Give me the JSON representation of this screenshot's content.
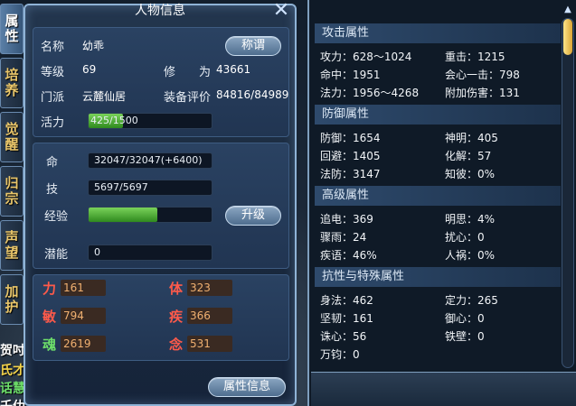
{
  "window": {
    "title": "人物信息",
    "close_glyph": "✕"
  },
  "side_tabs": [
    {
      "label": "属性",
      "active": true
    },
    {
      "label": "培养",
      "active": false
    },
    {
      "label": "觉醒",
      "active": false
    },
    {
      "label": "归宗",
      "active": false
    },
    {
      "label": "声望",
      "active": false
    },
    {
      "label": "加护",
      "active": false
    }
  ],
  "chat": [
    {
      "text": "贺吋"
    },
    {
      "text": "氏才"
    },
    {
      "text": "话慧"
    },
    {
      "text": "壬仂"
    }
  ],
  "profile": {
    "name_label": "名称",
    "name": "幼乖",
    "title_button": "称谓",
    "level_label": "等级",
    "level": "69",
    "cultivation_label": "修　　为",
    "cultivation": "43661",
    "sect_label": "门派",
    "sect": "云麓仙居",
    "equip_label": "装备评价",
    "equip_score": "84816/84989",
    "vitality_label": "活力",
    "vitality": "425/1500",
    "vitality_ratio": 0.283
  },
  "status": {
    "hp_label": "命",
    "hp": "32047/32047(+6400)",
    "skill_label": "技",
    "skill": "5697/5697",
    "exp_label": "经验",
    "exp_ratio": 0.56,
    "upgrade_button": "升级",
    "potential_label": "潜能",
    "potential": "0"
  },
  "stats": [
    {
      "label": "力",
      "value": "161"
    },
    {
      "label": "体",
      "value": "323"
    },
    {
      "label": "敏",
      "value": "794"
    },
    {
      "label": "疾",
      "value": "366"
    },
    {
      "label": "魂",
      "value": "2619"
    },
    {
      "label": "念",
      "value": "531"
    }
  ],
  "attr_info_button": "属性信息",
  "attributes": {
    "attack": {
      "title": "攻击属性",
      "rows": [
        [
          "攻力：628～1024",
          "重击：1215"
        ],
        [
          "命中：1951",
          "会心一击：798"
        ],
        [
          "法力：1956～4268",
          "附加伤害：131"
        ]
      ]
    },
    "defense": {
      "title": "防御属性",
      "rows": [
        [
          "防御：1654",
          "神明：405"
        ],
        [
          "回避：1405",
          "化解：57"
        ],
        [
          "法防：3147",
          "知彼：0%"
        ]
      ]
    },
    "advanced": {
      "title": "高级属性",
      "rows": [
        [
          "追电：369",
          "明思：4%"
        ],
        [
          "骤雨：24",
          "扰心：0"
        ],
        [
          "疾语：46%",
          "人祸：0%"
        ]
      ]
    },
    "resist": {
      "title": "抗性与特殊属性",
      "rows": [
        [
          "身法：462",
          "定力：265"
        ],
        [
          "坚韧：161",
          "御心：0"
        ],
        [
          "诛心：56",
          "铁壁：0"
        ],
        [
          "万钧：0",
          ""
        ]
      ]
    }
  },
  "colors": {
    "stat_label_red": "#ff5a4a",
    "stat_value_orange": "#f0b070",
    "soul_label_green": "#6ee06a",
    "tab_gold": "#e9c66a",
    "exp_green": "#4cbf2e"
  }
}
